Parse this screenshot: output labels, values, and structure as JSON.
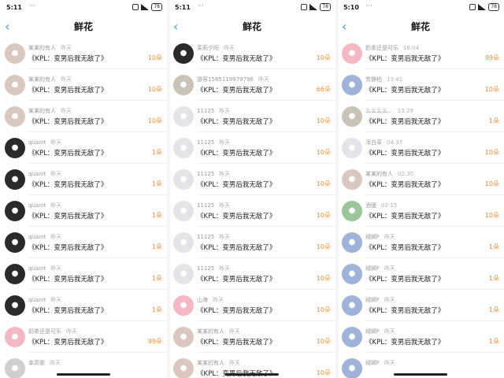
{
  "screens": [
    {
      "status": {
        "time": "5:11",
        "dots": "···",
        "battery": "78"
      },
      "nav": {
        "back_glyph": "‹",
        "title": "鲜花"
      },
      "rows": [
        {
          "avatar": "girl-avatar",
          "name": "某某的有人",
          "time": "昨天",
          "message": "《KPL：变男后我无敌了》",
          "count": "10朵"
        },
        {
          "avatar": "girl-avatar",
          "name": "某某的有人",
          "time": "昨天",
          "message": "《KPL：变男后我无敌了》",
          "count": "10朵"
        },
        {
          "avatar": "girl-avatar",
          "name": "某某的有人",
          "time": "昨天",
          "message": "《KPL：变男后我无敌了》",
          "count": "10朵"
        },
        {
          "avatar": "dark-avatar",
          "name": "quaint",
          "time": "昨天",
          "message": "《KPL：变男后我无敌了》",
          "count": "1朵"
        },
        {
          "avatar": "dark-avatar",
          "name": "quaint",
          "time": "昨天",
          "message": "《KPL：变男后我无敌了》",
          "count": "1朵"
        },
        {
          "avatar": "dark-avatar",
          "name": "quaint",
          "time": "昨天",
          "message": "《KPL：变男后我无敌了》",
          "count": "1朵"
        },
        {
          "avatar": "dark-avatar",
          "name": "quaint",
          "time": "昨天",
          "message": "《KPL：变男后我无敌了》",
          "count": "1朵"
        },
        {
          "avatar": "dark-avatar",
          "name": "quaint",
          "time": "昨天",
          "message": "《KPL：变男后我无敌了》",
          "count": "1朵"
        },
        {
          "avatar": "dark-avatar",
          "name": "quaint",
          "time": "昨天",
          "message": "《KPL：变男后我无敌了》",
          "count": "1朵"
        },
        {
          "avatar": "pink-avatar",
          "name": "奶茶还是可乐",
          "time": "昨天",
          "message": "《KPL：变男后我无敌了》",
          "count": "99朵"
        },
        {
          "avatar": "grey-avatar",
          "name": "幸高歌",
          "time": "昨天",
          "message": "",
          "count": ""
        }
      ]
    },
    {
      "status": {
        "time": "5:11",
        "dots": "···",
        "battery": "78"
      },
      "nav": {
        "back_glyph": "‹",
        "title": "鲜花"
      },
      "rows": [
        {
          "avatar": "dark-avatar",
          "name": "茉莉夕阳",
          "time": "昨天",
          "message": "《KPL：变男后我无敌了》",
          "count": "10朵"
        },
        {
          "avatar": "cat-avatar",
          "name": "游客15851199797​96",
          "time": "昨天",
          "message": "《KPL：变男后我无敌了》",
          "count": "66朵"
        },
        {
          "avatar": "boy-avatar",
          "name": "11125",
          "time": "昨天",
          "message": "《KPL：变男后我无敌了》",
          "count": "10朵"
        },
        {
          "avatar": "boy-avatar",
          "name": "11125",
          "time": "昨天",
          "message": "《KPL：变男后我无敌了》",
          "count": "10朵"
        },
        {
          "avatar": "boy-avatar",
          "name": "11125",
          "time": "昨天",
          "message": "《KPL：变男后我无敌了》",
          "count": "10朵"
        },
        {
          "avatar": "boy-avatar",
          "name": "11125",
          "time": "昨天",
          "message": "《KPL：变男后我无敌了》",
          "count": "10朵"
        },
        {
          "avatar": "boy-avatar",
          "name": "11125",
          "time": "昨天",
          "message": "《KPL：变男后我无敌了》",
          "count": "10朵"
        },
        {
          "avatar": "boy-avatar",
          "name": "11125",
          "time": "昨天",
          "message": "《KPL：变男后我无敌了》",
          "count": "10朵"
        },
        {
          "avatar": "pink-avatar",
          "name": "山海",
          "time": "昨天",
          "message": "《KPL：变男后我无敌了》",
          "count": "10朵"
        },
        {
          "avatar": "girl-avatar",
          "name": "某某的有人",
          "time": "昨天",
          "message": "《KPL：变男后我无敌了》",
          "count": "10朵"
        },
        {
          "avatar": "girl-avatar",
          "name": "某某的有人",
          "time": "昨天",
          "message": "《KPL：变男后我无敌了》",
          "count": "10朵"
        }
      ]
    },
    {
      "status": {
        "time": "5:10",
        "dots": "···",
        "battery": "78"
      },
      "nav": {
        "back_glyph": "‹",
        "title": "鲜花"
      },
      "rows": [
        {
          "avatar": "pink-avatar",
          "name": "奶茶还是可乐",
          "time": "16:04",
          "message": "《KPL：变男后我无敌了》",
          "count": "99朵"
        },
        {
          "avatar": "blue-avatar",
          "name": "劳静柏",
          "time": "13:41",
          "message": "《KPL：变男后我无敌了》",
          "count": "10朵"
        },
        {
          "avatar": "cat-avatar",
          "name": "么么么么...",
          "time": "13:29",
          "message": "《KPL：变男后我无敌了》",
          "count": "1朵"
        },
        {
          "avatar": "boy-avatar",
          "name": "浑白草",
          "time": "04:37",
          "message": "《KPL：变男后我无敌了》",
          "count": "10朵"
        },
        {
          "avatar": "girl-avatar",
          "name": "某某的有人",
          "time": "02:30",
          "message": "《KPL：变男后我无敌了》",
          "count": "10朵"
        },
        {
          "avatar": "green-avatar",
          "name": "洒骚",
          "time": "02:15",
          "message": "《KPL：变男后我无敌了》",
          "count": "10朵"
        },
        {
          "avatar": "blue-avatar",
          "name": "绒卿F",
          "time": "昨天",
          "message": "《KPL：变男后我无敌了》",
          "count": "1朵"
        },
        {
          "avatar": "blue-avatar",
          "name": "绒卿F",
          "time": "昨天",
          "message": "《KPL：变男后我无敌了》",
          "count": "1朵"
        },
        {
          "avatar": "blue-avatar",
          "name": "绒卿F",
          "time": "昨天",
          "message": "《KPL：变男后我无敌了》",
          "count": "1朵"
        },
        {
          "avatar": "blue-avatar",
          "name": "绒卿F",
          "time": "昨天",
          "message": "《KPL：变男后我无敌了》",
          "count": "1朵"
        },
        {
          "avatar": "blue-avatar",
          "name": "绒卿F",
          "time": "昨天",
          "message": "",
          "count": ""
        }
      ]
    }
  ],
  "colors": {
    "accent": "#29a3ee",
    "count": "#f08c32"
  }
}
